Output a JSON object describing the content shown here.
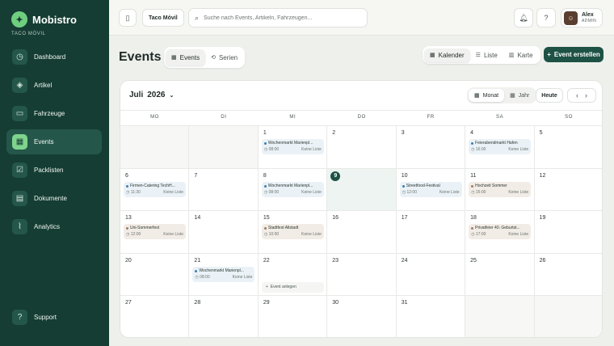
{
  "brand": {
    "name": "Mobistro",
    "subtitle": "TACO MÓVIL"
  },
  "nav": [
    {
      "label": "Dashboard",
      "icon": "dashboard-icon",
      "glyph": "◷"
    },
    {
      "label": "Artikel",
      "icon": "tag-icon",
      "glyph": "◈"
    },
    {
      "label": "Fahrzeuge",
      "icon": "truck-icon",
      "glyph": "▭"
    },
    {
      "label": "Events",
      "icon": "calendar-icon",
      "glyph": "▦",
      "active": true
    },
    {
      "label": "Packlisten",
      "icon": "checklist-icon",
      "glyph": "☑"
    },
    {
      "label": "Dokumente",
      "icon": "document-icon",
      "glyph": "▤"
    },
    {
      "label": "Analytics",
      "icon": "chart-icon",
      "glyph": "⌇"
    }
  ],
  "support": {
    "label": "Support"
  },
  "topbar": {
    "org": "Taco Móvil",
    "search_placeholder": "Suche nach Events, Artikeln, Fahrzeugen...",
    "user_name": "Alex",
    "user_role": "ADMIN"
  },
  "page": {
    "title": "Events",
    "tabs": [
      "Events",
      "Serien"
    ],
    "views": [
      "Kalender",
      "Liste",
      "Karte"
    ],
    "create_label": "Event erstellen"
  },
  "calendar": {
    "month": "Juli",
    "year": "2026",
    "ranges": [
      "Monat",
      "Jahr"
    ],
    "today_label": "Heute",
    "weekdays": [
      "MO",
      "DI",
      "MI",
      "DO",
      "FR",
      "SA",
      "SO"
    ],
    "add_event_label": "Event anlegen",
    "cells": [
      {
        "day": "",
        "out": true
      },
      {
        "day": "",
        "out": true
      },
      {
        "day": "1",
        "event": {
          "title": "Wochenmarkt Marienpl...",
          "time": "08:00",
          "list": "Keine Liste",
          "color": "blue"
        }
      },
      {
        "day": "2"
      },
      {
        "day": "3"
      },
      {
        "day": "4",
        "event": {
          "title": "Feierabendmarkt Hafen",
          "time": "16:00",
          "list": "Keine Liste",
          "color": "blue"
        }
      },
      {
        "day": "5"
      },
      {
        "day": "6",
        "event": {
          "title": "Firmen-Catering TechH...",
          "time": "11:30",
          "list": "Keine Liste",
          "color": "blue"
        }
      },
      {
        "day": "7"
      },
      {
        "day": "8",
        "event": {
          "title": "Wochenmarkt Marienpl...",
          "time": "08:00",
          "list": "Keine Liste",
          "color": "blue"
        }
      },
      {
        "day": "9",
        "today": true
      },
      {
        "day": "10",
        "event": {
          "title": "Streetfood-Festival",
          "time": "12:00",
          "list": "Keine Liste",
          "color": "blue"
        }
      },
      {
        "day": "11",
        "event": {
          "title": "Hochzeit Sommer",
          "time": "15:00",
          "list": "Keine Liste",
          "color": "tan"
        }
      },
      {
        "day": "12"
      },
      {
        "day": "13",
        "event": {
          "title": "Uni-Sommerfest",
          "time": "12:00",
          "list": "Keine Liste",
          "color": "tan"
        }
      },
      {
        "day": "14"
      },
      {
        "day": "15",
        "event": {
          "title": "Stadtfest Altstadt",
          "time": "10:00",
          "list": "Keine Liste",
          "color": "tan"
        }
      },
      {
        "day": "16"
      },
      {
        "day": "17"
      },
      {
        "day": "18",
        "event": {
          "title": "Privatfeier 40. Geburtst...",
          "time": "17:00",
          "list": "Keine Liste",
          "color": "tan"
        }
      },
      {
        "day": "19"
      },
      {
        "day": "20"
      },
      {
        "day": "21",
        "event": {
          "title": "Wochenmarkt Marienpl...",
          "time": "08:00",
          "list": "Keine Liste",
          "color": "blue"
        }
      },
      {
        "day": "22",
        "add": true
      },
      {
        "day": "23"
      },
      {
        "day": "24"
      },
      {
        "day": "25"
      },
      {
        "day": "26"
      },
      {
        "day": "27"
      },
      {
        "day": "28"
      },
      {
        "day": "29"
      },
      {
        "day": "30"
      },
      {
        "day": "31"
      },
      {
        "day": "",
        "out": true
      },
      {
        "day": "",
        "out": true
      }
    ]
  }
}
